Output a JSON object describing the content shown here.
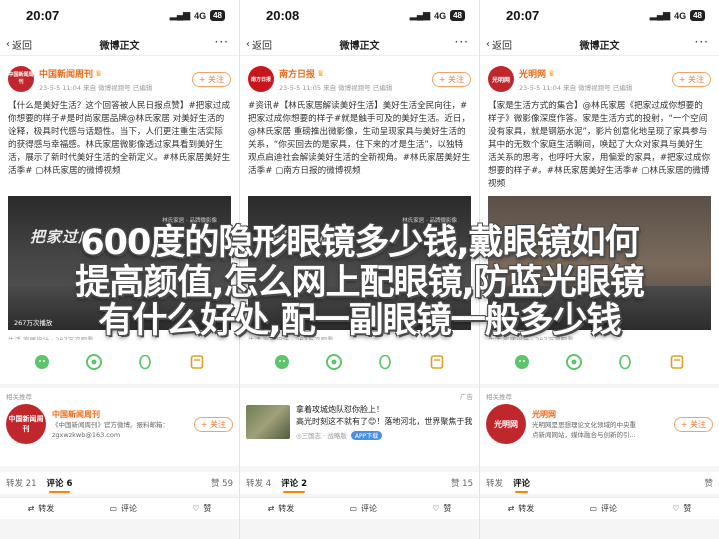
{
  "overlay": {
    "line1": "600度的隐形眼镜多少钱,戴眼镜如何",
    "line2": "提高颜值,怎么网上配眼镜,防蓝光眼镜",
    "line3": "有什么好处,配一副眼镜一般多少钱"
  },
  "colors": {
    "accent": "#eb7340",
    "brand_orange": "#ff8200",
    "text": "#333333"
  },
  "panels": [
    {
      "status_time": "20:07",
      "signal": "4G",
      "battery": "48",
      "back": "返回",
      "nav_title": "微博正文",
      "author": {
        "name": "中国新闻周刊",
        "avatar_text": "中国新闻周刊",
        "avatar_color": "#c0272d",
        "meta": "23-5-5 11:04 来自 微博视频号 已编辑",
        "follow": "+ 关注"
      },
      "text": "【什么是美好生活？这个回答被人民日报点赞】#把家过成你想要的样子#是时尚家居品牌@林氏家居 对美好生活的诠释，极具时代感与话题性。当下，人们更注重生活实际的获得感与幸福感。林氏家居微影像透过家具看到美好生活，展示了新时代美好生活的全新定义。#林氏家居美好生活季# ▢林氏家居的微博视频",
      "video": {
        "headline": "把家过成",
        "meta": "267万次播放",
        "logo": "林氏家居 · 品牌微影像"
      },
      "source": "生活 家居设计 · 267万次观看",
      "recommend": {
        "label": "相关推荐",
        "ad": "",
        "name": "中国新闻周刊",
        "avatar_text": "中国新闻周刊",
        "desc": "《中国新闻周刊》官方微博。报料邮箱：",
        "desc2": "zgxwzkwb@163.com",
        "follow": "+ 关注"
      },
      "tabs": {
        "repost": "转发 21",
        "comment": "评论 6",
        "like": "赞 59"
      },
      "bottom": {
        "repost": "转发",
        "comment": "评论",
        "like": "赞"
      }
    },
    {
      "status_time": "20:08",
      "signal": "4G",
      "battery": "48",
      "back": "返回",
      "nav_title": "微博正文",
      "author": {
        "name": "南方日报",
        "avatar_text": "南方日报",
        "avatar_color": "#c8161e",
        "meta": "23-5-5 11:05 来自 微博视频号 已编辑",
        "follow": "+ 关注"
      },
      "text": "#资讯#【林氏家居解读美好生活】美好生活全民向往，#把家过成你想要的样子#就是触手可及的美好生活。近日，@林氏家居 重磅推出微影像，生动呈现家具与美好生活的关系，“你买回去的是家具，住下来的才是生活”，以独特观点启迪社会解读美好生活的全新视角。#林氏家居美好生活季# ▢南方日报的微博视频",
      "video": {
        "headline": "把家过成",
        "meta": "",
        "logo": "林氏家居 · 品牌微影像"
      },
      "source": "生活 家居设计 · 267万次观看",
      "recommend": {
        "label": "",
        "ad": "广告",
        "title": "拿到攻城炮！高光时刻这不就有了😊！落地河北，世界聚焦于我",
        "title_prefix": "拿着攻城炮队怼你脸上！",
        "sub": "◎三国志 · 战略版",
        "app": "APP下载"
      },
      "tabs": {
        "repost": "转发 4",
        "comment": "评论 2",
        "like": "赞 15"
      },
      "bottom": {
        "repost": "转发",
        "comment": "评论",
        "like": "赞"
      }
    },
    {
      "status_time": "20:07",
      "signal": "4G",
      "battery": "48",
      "back": "返回",
      "nav_title": "微博正文",
      "author": {
        "name": "光明网",
        "avatar_text": "光明网",
        "avatar_color": "#c0272d",
        "meta": "23-5-5 11:04 来自 微博视频号 已编辑",
        "follow": "+ 关注"
      },
      "text": "【家是生活方式的集合】@林氏家居《把家过成你想要的样子》微影像深度作答。家是生活方式的投射，“一个空间没有家具，就是钢筋水泥”，影片创意化地呈现了家具参与其中的无数个家庭生活瞬间，唤起了大众对家具与美好生活关系的思考，也呼吁大家，用偏爱的家具，#把家过成你想要的样子#。#林氏家居美好生活季# ▢林氏家居的微博视频",
      "video": {
        "headline": "",
        "meta": "",
        "logo": ""
      },
      "source": "生活 家居设计 · 267万次观看",
      "recommend": {
        "label": "相关推荐",
        "ad": "",
        "name": "光明网",
        "avatar_text": "光明网",
        "desc": "光明网是思想理论文化领域的中央重",
        "desc2": "点新闻网站，媒体融合与创新的引...",
        "follow": "+ 关注"
      },
      "tabs": {
        "repost": "转发",
        "comment": "评论",
        "like": "赞"
      },
      "bottom": {
        "repost": "转发",
        "comment": "评论",
        "like": "赞"
      }
    }
  ]
}
